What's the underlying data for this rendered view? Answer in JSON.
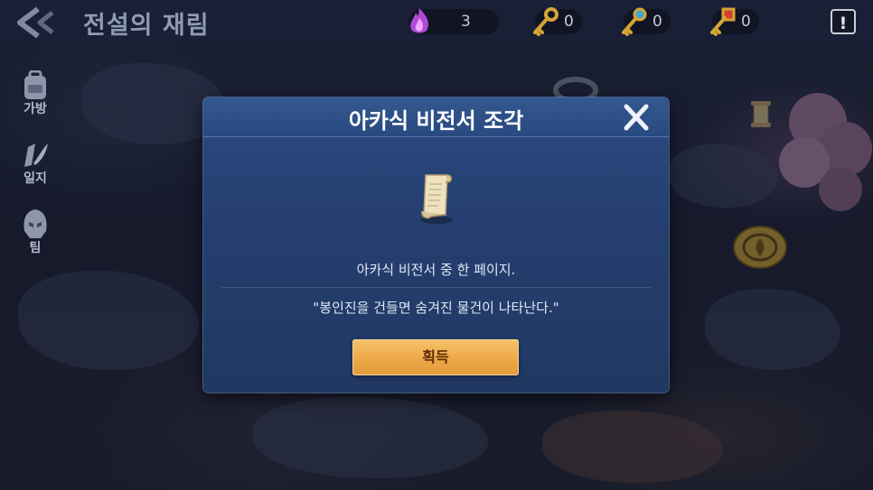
{
  "header": {
    "title": "전설의 재림",
    "back_icon": "back-arrow-icon",
    "alert_label": "!"
  },
  "resources": [
    {
      "icon": "purple-flame-icon",
      "count": "3"
    },
    {
      "icon": "gold-key-icon",
      "count": "0"
    },
    {
      "icon": "blue-gem-key-icon",
      "count": "0"
    },
    {
      "icon": "red-gem-key-icon",
      "count": "0"
    }
  ],
  "sidebar": {
    "items": [
      {
        "label": "가방",
        "icon": "backpack-icon"
      },
      {
        "label": "일지",
        "icon": "quill-journal-icon"
      },
      {
        "label": "팀",
        "icon": "helmet-icon"
      }
    ]
  },
  "dialog": {
    "title": "아카식 비전서 조각",
    "icon": "scroll-icon",
    "description": "아카식 비전서 중 한 페이지.",
    "quote": "\"봉인진을 건들면 숨겨진 물건이 나타난다.\"",
    "button_label": "획득"
  },
  "colors": {
    "dialog_bg": "#253f70",
    "button": "#eea848",
    "title_text": "#ffffff"
  }
}
